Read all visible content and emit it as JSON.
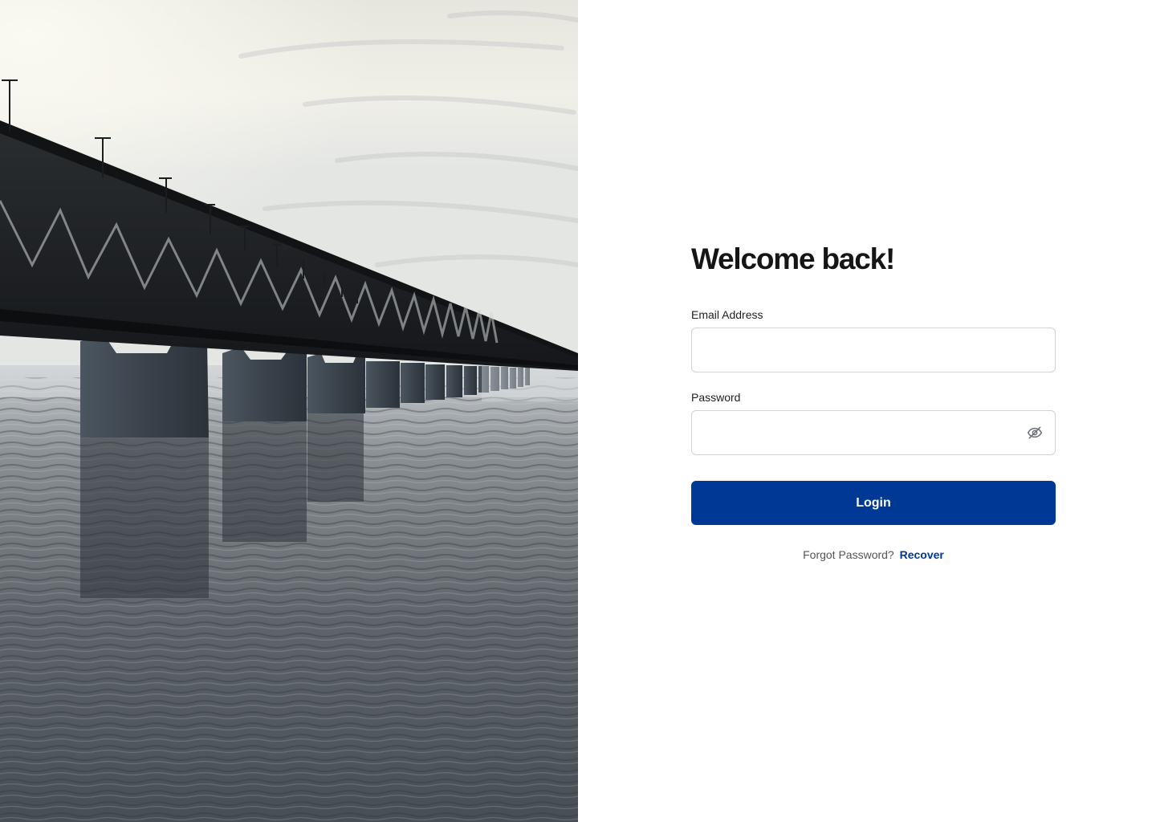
{
  "auth": {
    "title": "Welcome back!",
    "email": {
      "label": "Email Address",
      "value": "",
      "placeholder": ""
    },
    "password": {
      "label": "Password",
      "value": "",
      "placeholder": ""
    },
    "login_label": "Login",
    "forgot_text": "Forgot Password?",
    "recover_label": "Recover"
  },
  "icons": {
    "password_toggle": "eye-off-icon"
  },
  "colors": {
    "accent": "#003896",
    "title": "#151515",
    "input_border": "#d3d3d3",
    "muted_text": "#555555"
  }
}
